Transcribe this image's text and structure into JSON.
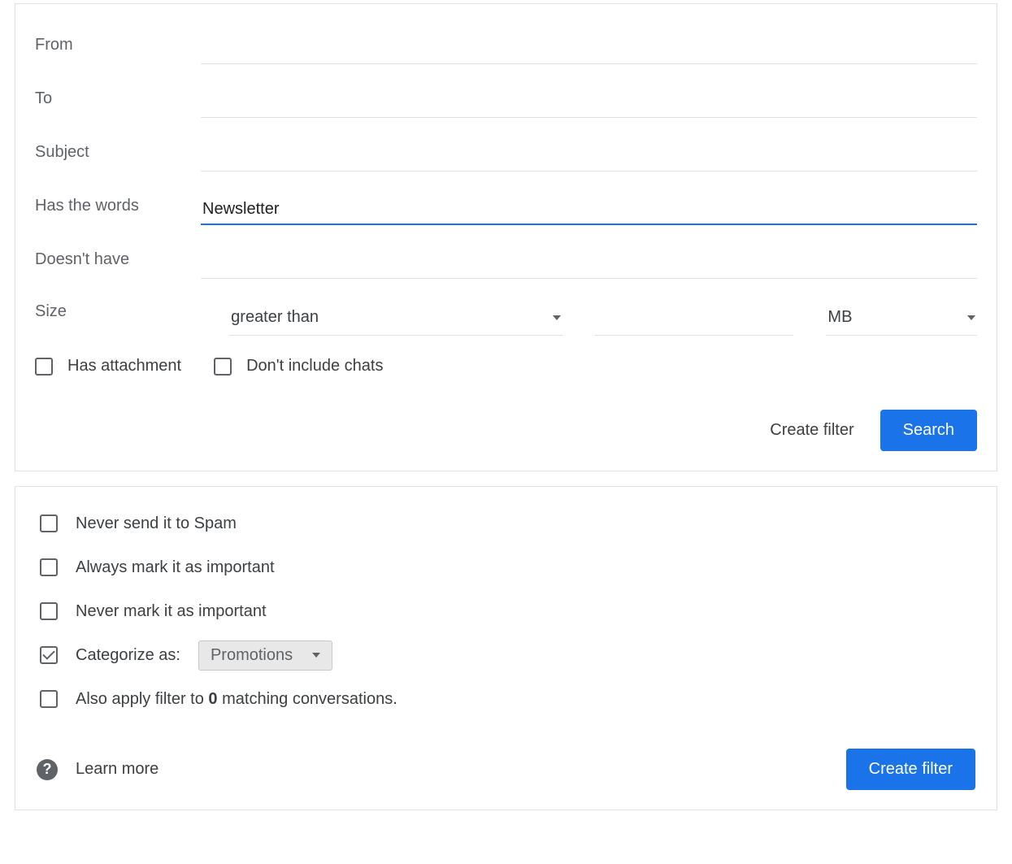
{
  "search": {
    "labels": {
      "from": "From",
      "to": "To",
      "subject": "Subject",
      "has_words": "Has the words",
      "doesnt_have": "Doesn't have",
      "size": "Size"
    },
    "values": {
      "from": "",
      "to": "",
      "subject": "",
      "has_words": "Newsletter",
      "doesnt_have": ""
    },
    "size": {
      "comparison": "greater than",
      "amount": "",
      "unit": "MB"
    },
    "checks": {
      "has_attachment": {
        "label": "Has attachment",
        "checked": false
      },
      "dont_include_chats": {
        "label": "Don't include chats",
        "checked": false
      }
    },
    "buttons": {
      "create_filter": "Create filter",
      "search": "Search"
    }
  },
  "actions": {
    "items": {
      "never_spam": {
        "label": "Never send it to Spam",
        "checked": false
      },
      "always_important": {
        "label": "Always mark it as important",
        "checked": false
      },
      "never_important": {
        "label": "Never mark it as important",
        "checked": false
      },
      "categorize": {
        "label": "Categorize as:",
        "checked": true,
        "value": "Promotions"
      }
    },
    "apply": {
      "checked": false,
      "prefix": "Also apply filter to ",
      "count": "0",
      "suffix": " matching conversations."
    },
    "help_glyph": "?",
    "learn_more": "Learn more",
    "create_filter": "Create filter"
  }
}
